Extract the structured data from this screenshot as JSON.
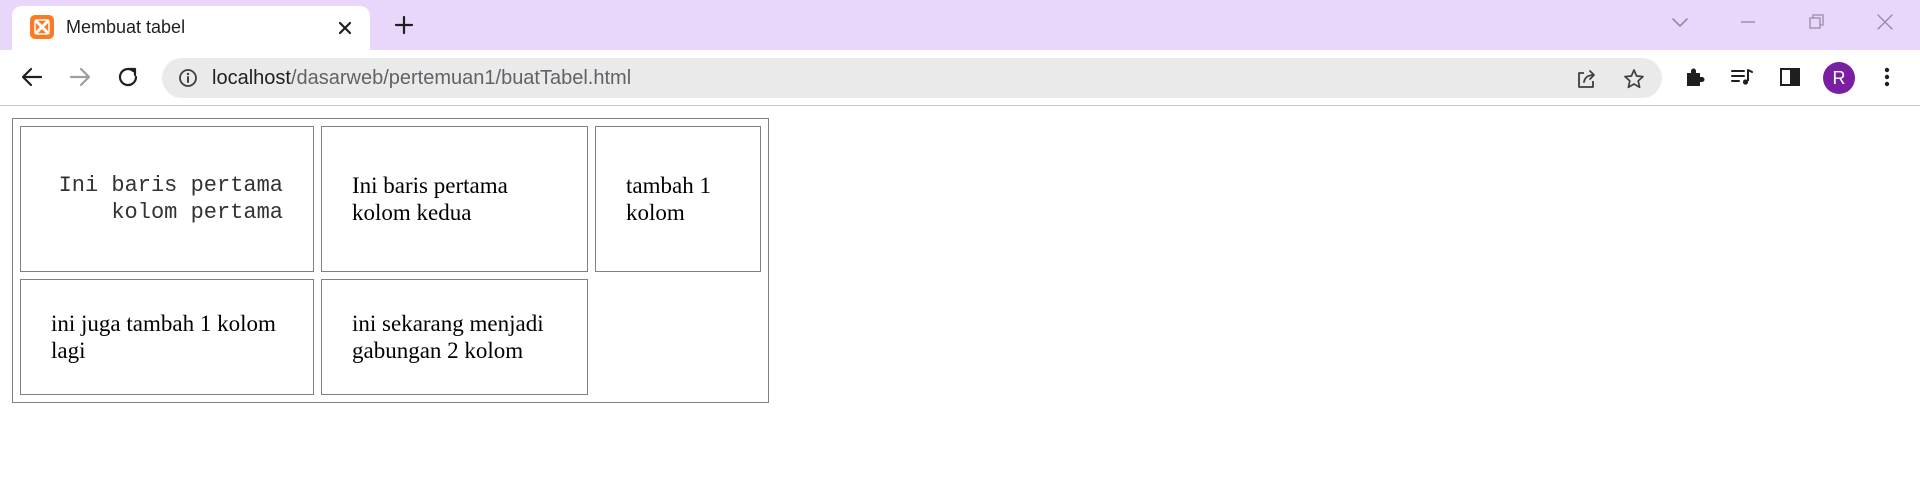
{
  "browser": {
    "tab": {
      "title": "Membuat tabel",
      "favicon": "xampp-icon"
    },
    "address_bar": {
      "host": "localhost",
      "path": "/dasarweb/pertemuan1/buatTabel.html"
    },
    "profile_initial": "R",
    "colors": {
      "tabstrip": "#e9d6fb",
      "profile": "#7b1fa2",
      "favicon": "#fb7a24"
    }
  },
  "table": {
    "rows": [
      {
        "cells": [
          "Ini baris pertama kolom pertama",
          "Ini baris pertama kolom kedua",
          "tambah 1 kolom"
        ]
      },
      {
        "cells": [
          "ini juga tambah 1 kolom lagi",
          "ini sekarang menjadi gabungan 2 kolom"
        ]
      }
    ]
  }
}
